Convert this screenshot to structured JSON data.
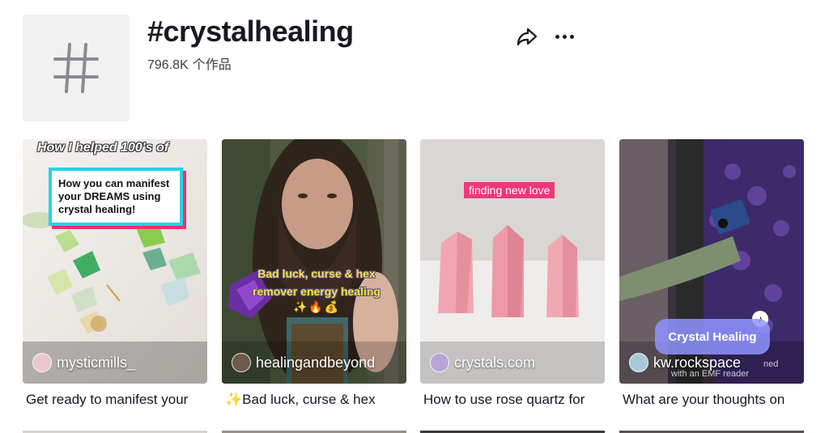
{
  "header": {
    "hashtag_title": "#crystalhealing",
    "video_count": "796.8K",
    "video_count_suffix": "个作品",
    "share_icon": "share-arrow-icon",
    "more_icon": "more-dots-icon"
  },
  "videos": [
    {
      "author": "mysticmills_",
      "caption": "Get ready to manifest your",
      "overlay_heading": "How I helped 100's of",
      "overlay_box": "How you can manifest your DREAMS using crystal healing!"
    },
    {
      "author": "healingandbeyond",
      "caption": "✨Bad luck, curse & hex",
      "overlay_text": "Bad luck, curse & hex remover energy healing",
      "overlay_emoji": "✨🔥💰"
    },
    {
      "author": "crystals.com",
      "caption": "How to use rose quartz for",
      "overlay_text": "finding new love"
    },
    {
      "author": "kw.rockspace",
      "caption": "What are your thoughts on",
      "overlay_pill": "Crystal Healing",
      "overlay_subtext": "with an EMF reader",
      "overlay_subtext_partial": "ned"
    }
  ],
  "colors": {
    "text_primary": "#161823",
    "pink_tag": "#f0367a",
    "cyan_border": "#25d4e4",
    "pill_purple": "#8f94ff"
  }
}
